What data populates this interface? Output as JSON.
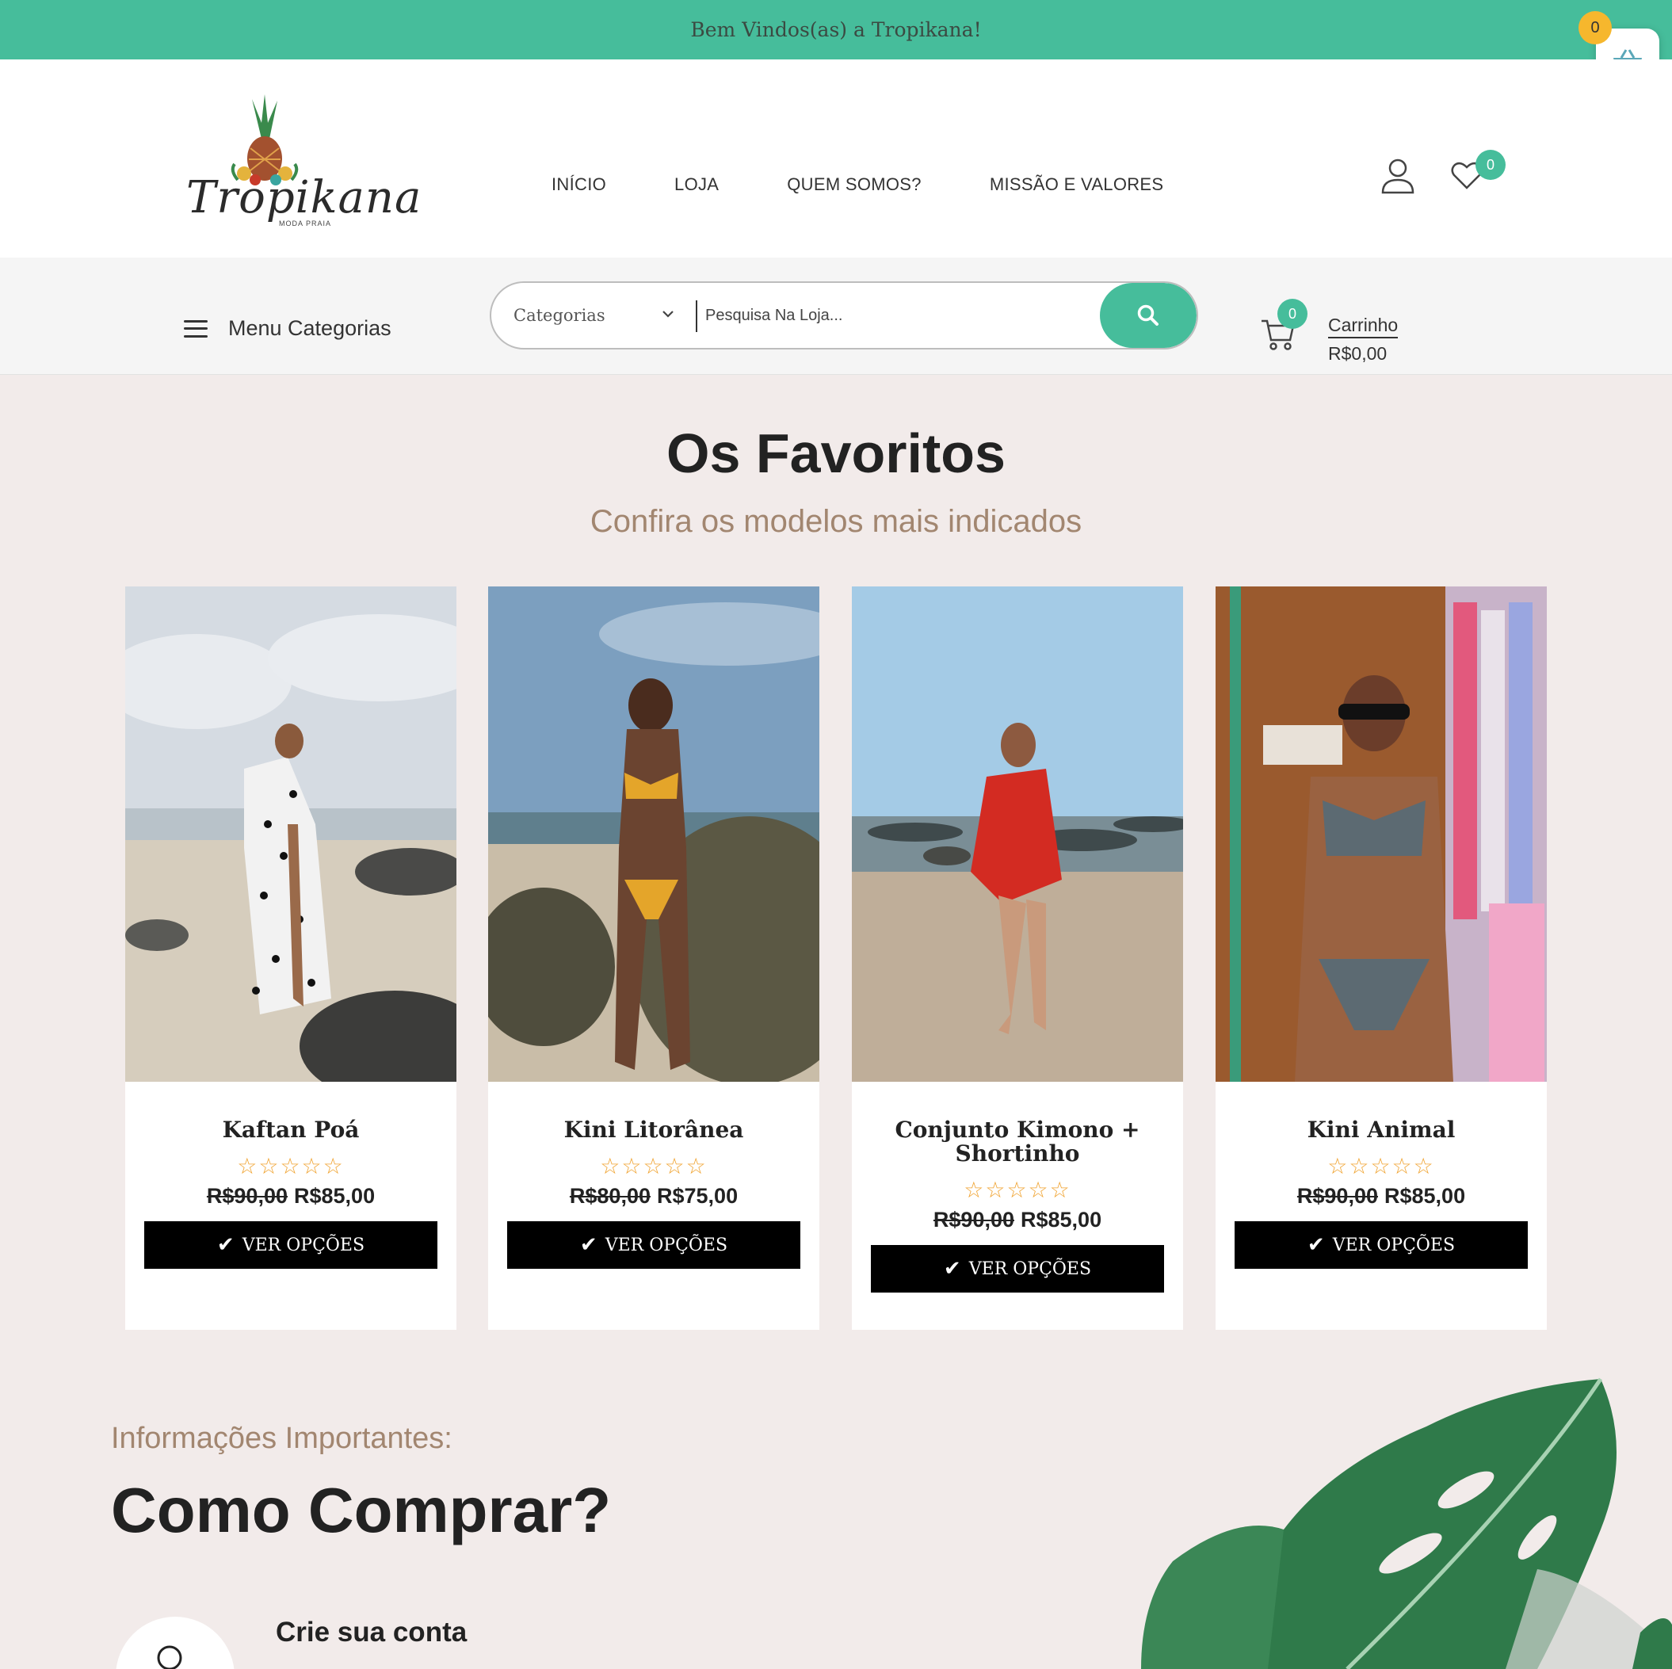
{
  "topbar": {
    "welcome": "Bem Vindos(as) a Tropikana!"
  },
  "floating_basket": {
    "count": "0"
  },
  "header": {
    "logo_text": "Tropikana",
    "logo_subtext": "MODA PRAIA",
    "nav": [
      "INÍCIO",
      "LOJA",
      "QUEM SOMOS?",
      "MISSÃO E VALORES"
    ],
    "wishlist_count": "0"
  },
  "search": {
    "menu_label": "Menu Categorias",
    "category_select": "Categorias",
    "placeholder": "Pesquisa Na Loja...",
    "cart_count": "0",
    "cart_label": "Carrinho",
    "cart_total": "R$0,00"
  },
  "favorites": {
    "title": "Os Favoritos",
    "subtitle": "Confira os modelos mais indicados",
    "button_label": "VER OPÇÕES",
    "products": [
      {
        "name": "Kaftan Poá",
        "rating": "☆☆☆☆☆",
        "old_price": "R$90,00",
        "price": "R$85,00"
      },
      {
        "name": "Kini Litorânea",
        "rating": "☆☆☆☆☆",
        "old_price": "R$80,00",
        "price": "R$75,00"
      },
      {
        "name": "Conjunto Kimono + Shortinho",
        "rating": "☆☆☆☆☆",
        "old_price": "R$90,00",
        "price": "R$85,00"
      },
      {
        "name": "Kini Animal",
        "rating": "☆☆☆☆☆",
        "old_price": "R$90,00",
        "price": "R$85,00"
      }
    ]
  },
  "info": {
    "subtitle": "Informações Importantes:",
    "title": "Como Comprar?",
    "step1_title": "Crie sua conta"
  },
  "colors": {
    "accent": "#46bd9b",
    "badge_yellow": "#f6b72d",
    "muted_brown": "#a28670",
    "background": "#f2ebea"
  }
}
